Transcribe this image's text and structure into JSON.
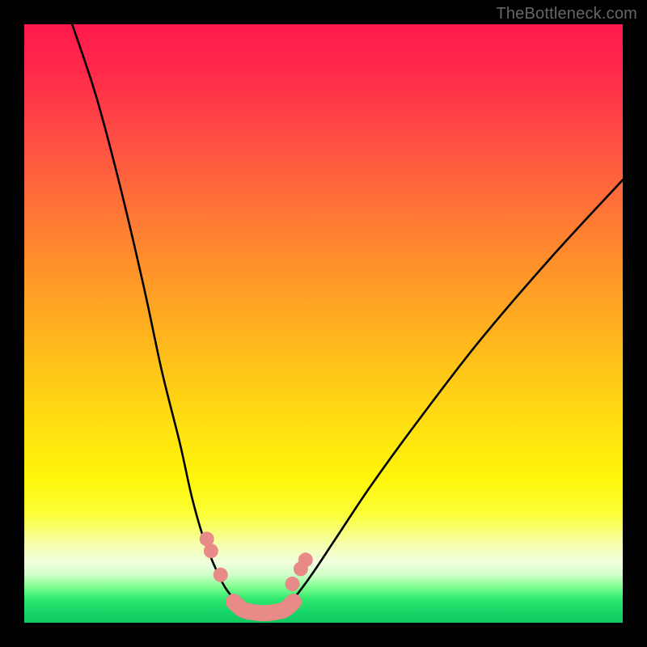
{
  "watermark": "TheBottleneck.com",
  "chart_data": {
    "type": "line",
    "title": "",
    "xlabel": "",
    "ylabel": "",
    "xlim": [
      0,
      100
    ],
    "ylim": [
      0,
      100
    ],
    "series": [
      {
        "name": "curve-left",
        "x": [
          8,
          12,
          16,
          20,
          23,
          26,
          28,
          30,
          32,
          33.5,
          35
        ],
        "values": [
          100,
          88,
          73,
          56,
          42,
          30,
          21,
          14,
          9,
          6,
          4
        ]
      },
      {
        "name": "curve-bottom",
        "x": [
          35,
          36.5,
          38,
          40,
          42,
          43.5,
          45
        ],
        "values": [
          4,
          2.5,
          2,
          1.8,
          2,
          2.5,
          4
        ]
      },
      {
        "name": "curve-right",
        "x": [
          45,
          48,
          52,
          58,
          66,
          76,
          88,
          100
        ],
        "values": [
          4,
          8,
          14,
          23,
          34,
          47,
          61,
          74
        ]
      },
      {
        "name": "markers-left",
        "x": [
          30.5,
          31.2,
          32.8
        ],
        "values": [
          14,
          12,
          8
        ]
      },
      {
        "name": "markers-right",
        "x": [
          44.8,
          46.2,
          47.0
        ],
        "values": [
          6.5,
          9,
          10.5
        ]
      },
      {
        "name": "bottom-blob",
        "x": [
          35,
          36.5,
          38,
          40,
          42,
          43.5,
          45
        ],
        "values": [
          3.5,
          2.2,
          1.8,
          1.6,
          1.8,
          2.2,
          3.5
        ]
      }
    ]
  }
}
